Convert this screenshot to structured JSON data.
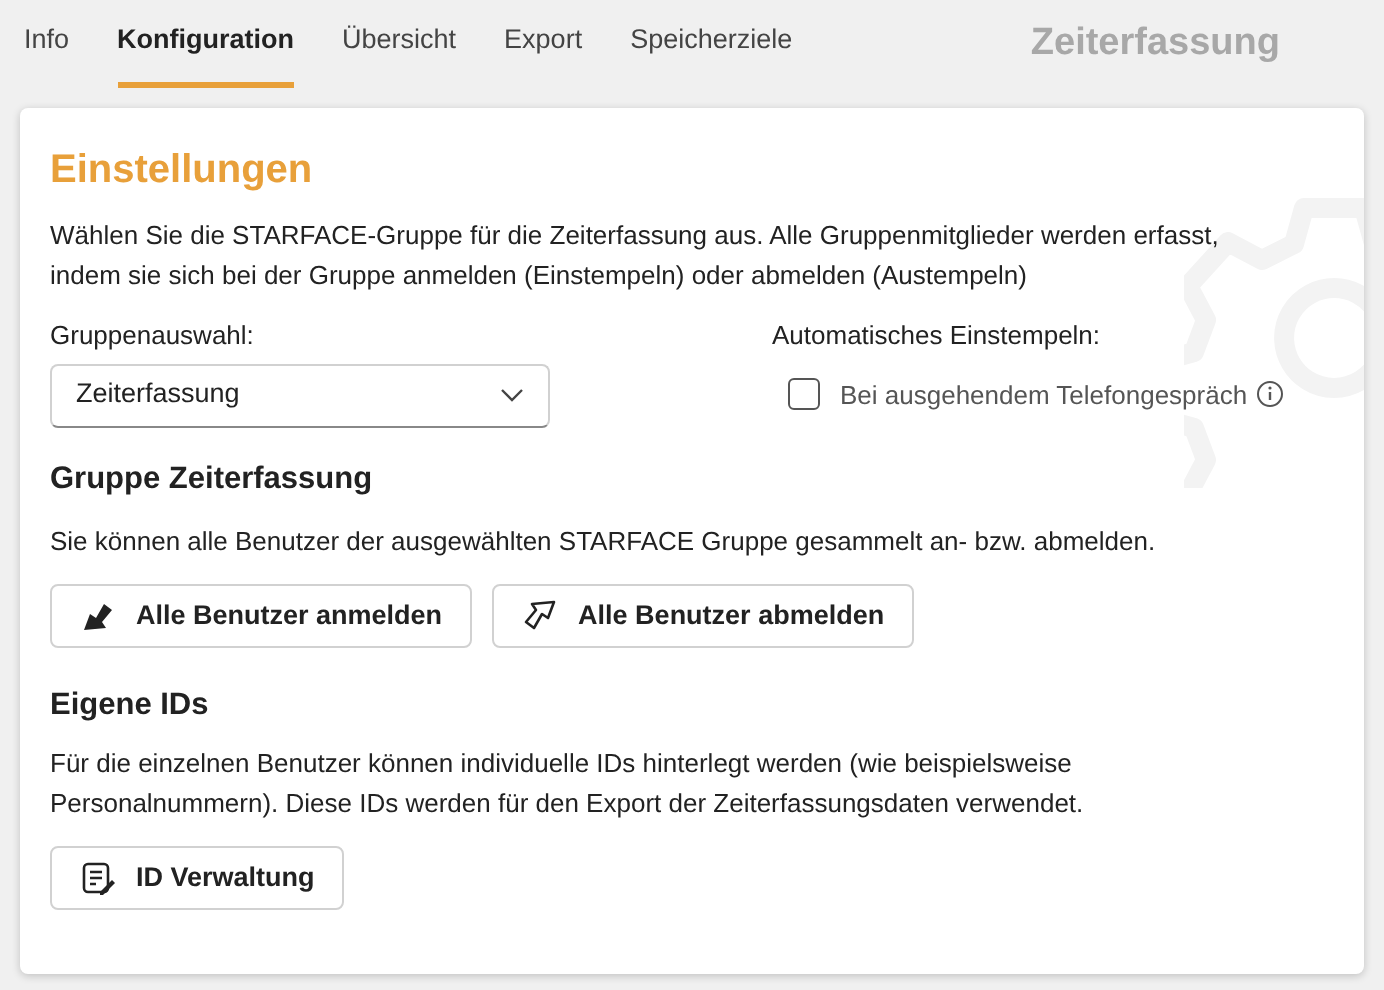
{
  "tabs": [
    {
      "label": "Info",
      "selected": false
    },
    {
      "label": "Konfiguration",
      "selected": true
    },
    {
      "label": "Übersicht",
      "selected": false
    },
    {
      "label": "Export",
      "selected": false
    },
    {
      "label": "Speicherziele",
      "selected": false
    }
  ],
  "app_title": "Zeiterfassung",
  "settings": {
    "title": "Einstellungen",
    "description": "Wählen Sie die STARFACE-Gruppe für die Zeiterfassung aus. Alle Gruppenmitglieder werden erfasst, indem sie sich bei der Gruppe anmelden (Einstempeln) oder abmelden (Austempeln)",
    "group_select": {
      "label": "Gruppenauswahl:",
      "value": "Zeiterfassung"
    },
    "auto_clock_in": {
      "label": "Automatisches Einstempeln:",
      "option": {
        "label": "Bei ausgehendem Telefongespräch",
        "checked": false
      }
    }
  },
  "group_section": {
    "title": "Gruppe Zeiterfassung",
    "description": "Sie können alle Benutzer der ausgewählten STARFACE Gruppe gesammelt an- bzw. abmelden.",
    "buttons": [
      {
        "label": "Alle Benutzer anmelden",
        "kind": "login"
      },
      {
        "label": "Alle Benutzer abmelden",
        "kind": "logout"
      }
    ]
  },
  "ids_section": {
    "title": "Eigene IDs",
    "description": "Für die einzelnen Benutzer können individuelle IDs hinterlegt werden (wie beispielsweise Personalnummern). Diese IDs werden für den Export der Zeiterfassungsdaten verwendet.",
    "buttons": [
      {
        "label": "ID Verwaltung",
        "kind": "list"
      }
    ]
  }
}
